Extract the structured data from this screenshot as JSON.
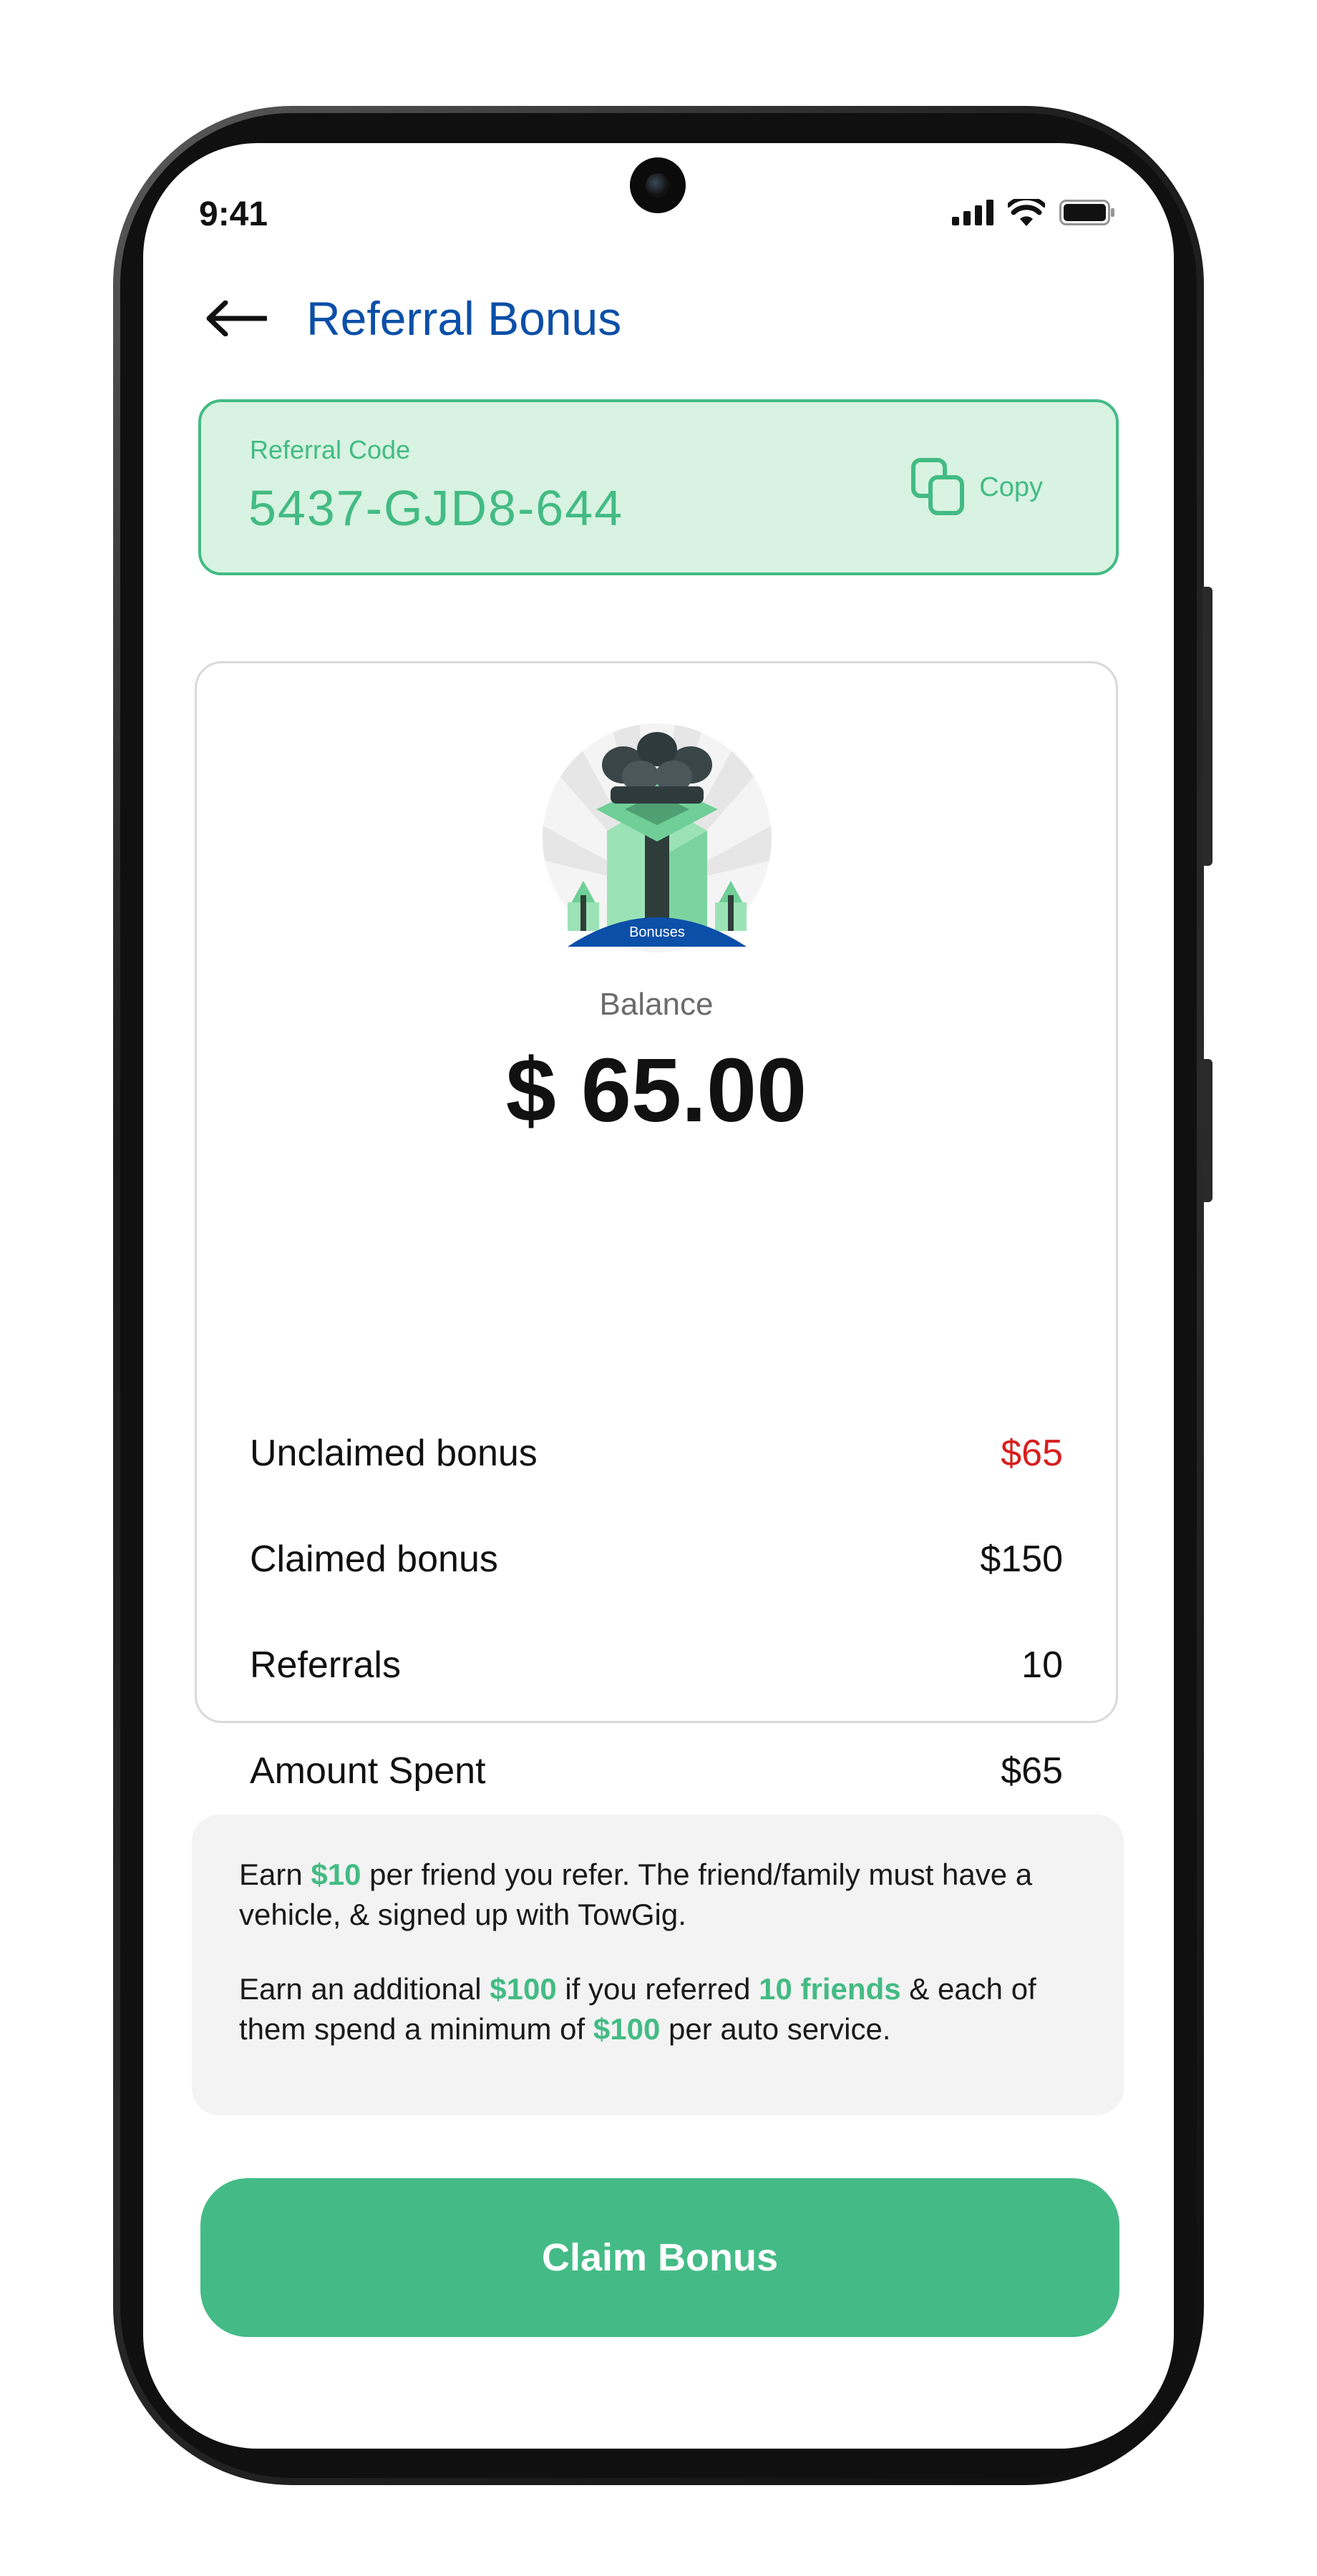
{
  "status_bar": {
    "time": "9:41"
  },
  "header": {
    "title": "Referral Bonus",
    "back_icon": "arrow-left-icon"
  },
  "referral": {
    "label": "Referral Code",
    "code": "5437-GJD8-644",
    "copy_label": "Copy",
    "copy_icon": "copy-icon"
  },
  "balance": {
    "illustration_badge": "Bonuses",
    "label": "Balance",
    "amount": "$ 65.00"
  },
  "stats": [
    {
      "label": "Unclaimed bonus",
      "value": "$65"
    },
    {
      "label": "Claimed bonus",
      "value": "$150"
    },
    {
      "label": "Referrals",
      "value": "10"
    },
    {
      "label": "Amount Spent",
      "value": "$65"
    }
  ],
  "info": {
    "p1_a": "Earn ",
    "p1_b": "$10",
    "p1_c": " per friend you refer. The friend/family must have a vehicle, & signed up with TowGig.",
    "p2_a": "Earn an additional ",
    "p2_b": "$100",
    "p2_c": " if you referred ",
    "p2_d": "10 friends",
    "p2_e": " & each of them spend a minimum of ",
    "p2_f": "$100",
    "p2_g": " per auto service."
  },
  "cta": {
    "label": "Claim Bonus"
  },
  "colors": {
    "brand_green": "#43bb84",
    "title_blue": "#0b4fa8",
    "alert_red": "#d71e1e",
    "code_bg": "#d8f3e1",
    "badge_blue": "#0b4fa8"
  }
}
